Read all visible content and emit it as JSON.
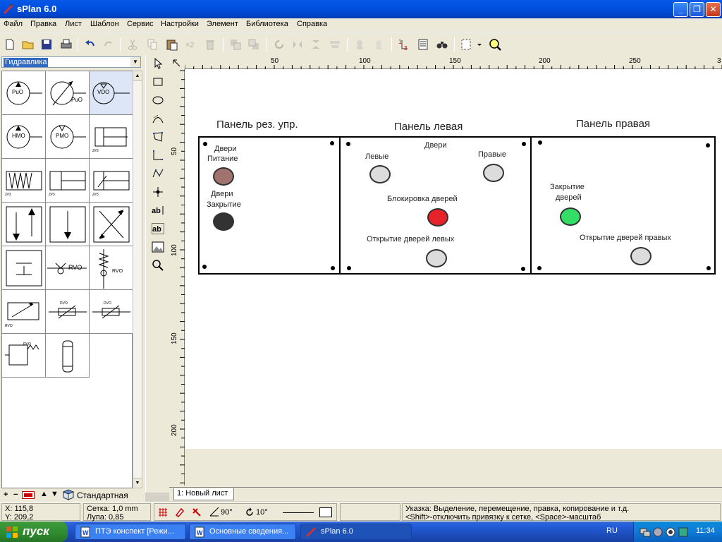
{
  "window": {
    "title": "sPlan 6.0",
    "minimize": "_",
    "maximize": "❐",
    "close": "✕"
  },
  "menu": [
    "Файл",
    "Правка",
    "Лист",
    "Шаблон",
    "Сервис",
    "Настройки",
    "Элемент",
    "Библиотека",
    "Справка"
  ],
  "library": {
    "selected": "Гидравлика",
    "footer_label": "Стандартная",
    "cells": [
      {
        "text": "PuO"
      },
      {
        "text": "PuO"
      },
      {
        "text": "VDO"
      },
      {
        "text": "HMO"
      },
      {
        "text": "PMO"
      },
      {
        "text": "Z#3"
      },
      {
        "text": "Z#3"
      },
      {
        "text": "Z#3"
      },
      {
        "text": "Z#3"
      },
      {
        "text": ""
      },
      {
        "text": ""
      },
      {
        "text": ""
      },
      {
        "text": ""
      },
      {
        "text": "RVO"
      },
      {
        "text": "RVO"
      },
      {
        "text": "RVO"
      },
      {
        "text": "DVO"
      },
      {
        "text": "DVO"
      },
      {
        "text": "RVO"
      },
      {
        "text": ""
      }
    ]
  },
  "rulers": {
    "top": [
      "50",
      "100",
      "150",
      "200",
      "250",
      "3"
    ],
    "left": [
      "50",
      "100",
      "150",
      "200"
    ]
  },
  "drawing": {
    "panel1": {
      "title": "Панель рез. упр.",
      "label1a": "Двери",
      "label1b": "Питание",
      "label2a": "Двери",
      "label2b": "Закрытие"
    },
    "panel2": {
      "title": "Панель левая",
      "doors": "Двери",
      "left": "Левые",
      "right": "Правые",
      "lock": "Блокировка   дверей",
      "open_left": "Открытие   дверей   левых"
    },
    "panel3": {
      "title": "Панель правая",
      "close_a": "Закрытие",
      "close_b": "дверей",
      "open_right": "Открытие   дверей   правых"
    },
    "colors": {
      "lamp_power": "#a0736e",
      "lamp_close": "#333333",
      "lamp_grey": "#dcdcdc",
      "lamp_red": "#e8222a",
      "lamp_green": "#33dd66"
    }
  },
  "sheet_tab": "1: Новый лист",
  "status": {
    "x": "X: 115,8",
    "y": "Y: 209,2",
    "grid": "Сетка:  1,0 mm",
    "zoom": "Лупа:   0,85",
    "angle1": "90°",
    "angle2": "10°",
    "hint1": "Указка: Выделение, перемещение, правка, копирование и т.д.",
    "hint2": "<Shift>-отключить привязку к сетке, <Space>-масштаб"
  },
  "taskbar": {
    "start": "пуск",
    "tasks": [
      "ПТЭ конспект [Режи...",
      "Основные сведения...",
      "sPlan 6.0"
    ],
    "lang": "RU",
    "clock": "11:34"
  }
}
